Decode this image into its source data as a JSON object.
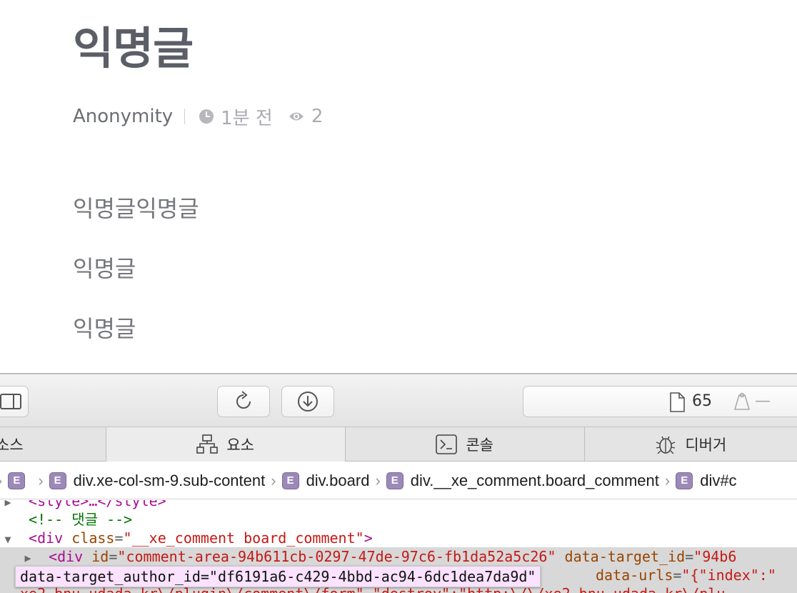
{
  "post": {
    "title": "익명글",
    "author": "Anonymity",
    "time": "1분 전",
    "views": "2",
    "lines": [
      "익명글익명글",
      "익명글",
      "익명글"
    ]
  },
  "devtools": {
    "activity_count": "65",
    "activity_dash": "—",
    "tabs": [
      "소스",
      "요소",
      "콘솔",
      "디버거"
    ],
    "breadcrumb": [
      "div.xe-col-sm-9.sub-content",
      "div.board",
      "div.__xe_comment.board_comment",
      "div#c"
    ],
    "badge_letter": "E",
    "dom": {
      "line0_text": "<style>…</style>",
      "comment": "<!-- 댓글 -->",
      "div_tag": "div",
      "class_attr": "class",
      "class_val": "\"__xe_comment board_comment\"",
      "id_attr": "id",
      "id_val": "\"comment-area-94b611cb-0297-47de-97c6-fb1da52a5c26\"",
      "target_attr": "data-target_id",
      "target_val": "\"94b6",
      "urls_attr": "data-urls",
      "urls_val": "\"{\"index\":\"",
      "line4_text": "xe2.bnu.udada.kr\\/plugin\\/comment\\/form\",\"destroy\":\"http:\\/\\/xe2.bnu.udada.kr\\/plu"
    },
    "tooltip": "data-target_author_id=\"df6191a6-c429-4bbd-ac94-6dc1dea7da9d\""
  },
  "colors": {
    "tag": "#aa0d91",
    "attribute": "#994500",
    "value": "#c41a16",
    "comment": "#007400",
    "tooltip_bg": "#fbe2ff"
  }
}
